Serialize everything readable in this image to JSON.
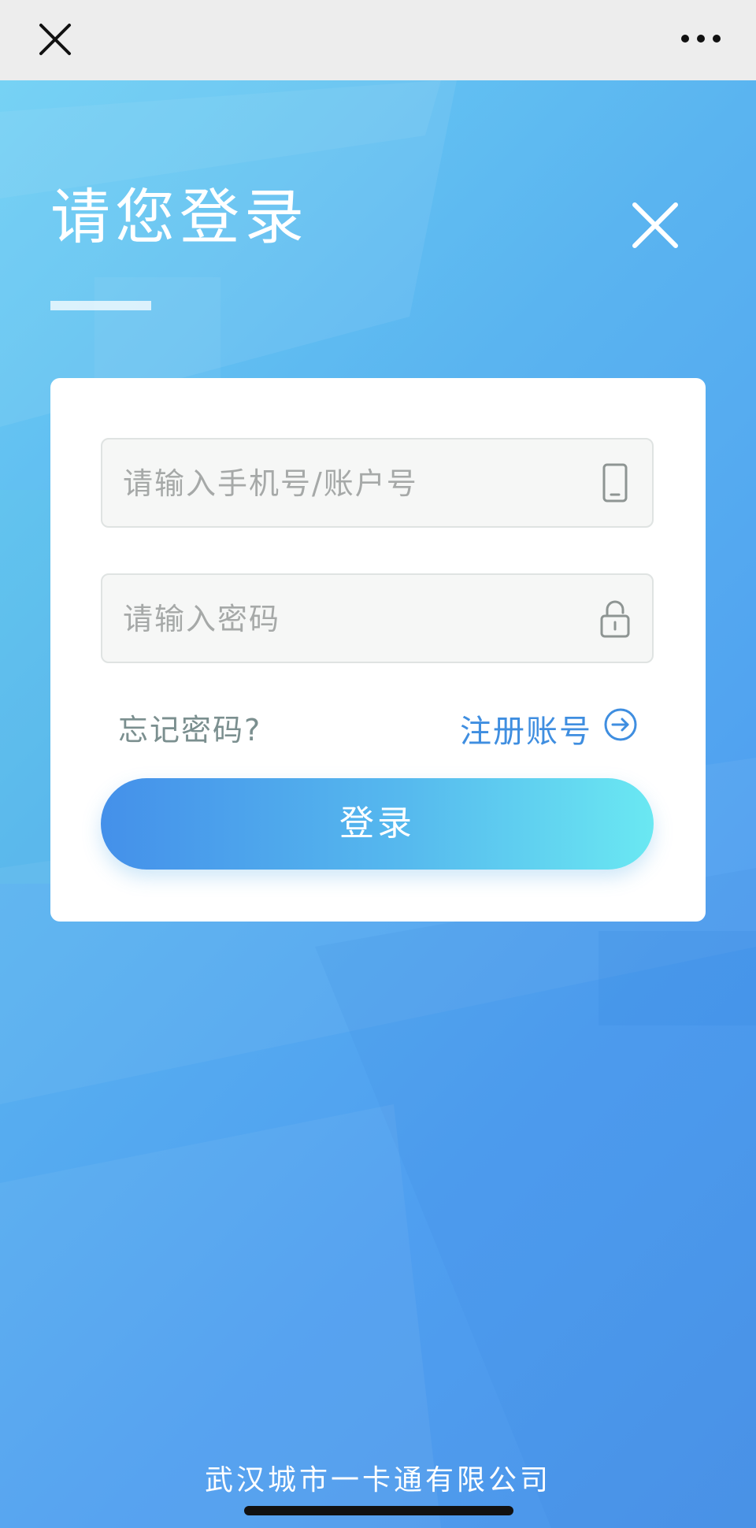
{
  "topbar": {
    "close_icon": "close-icon",
    "more_icon": "more-dots-icon"
  },
  "page": {
    "title": "请您登录",
    "close_icon": "close-icon"
  },
  "form": {
    "account_placeholder": "请输入手机号/账户号",
    "account_icon": "phone-icon",
    "password_placeholder": "请输入密码",
    "password_icon": "lock-icon",
    "forgot_label": "忘记密码?",
    "register_label": "注册账号",
    "register_icon": "arrow-right-circle-icon",
    "login_label": "登录"
  },
  "footer": {
    "company": "武汉城市一卡通有限公司"
  },
  "colors": {
    "accent": "#3f8ee0",
    "button_gradient_start": "#4490ea",
    "button_gradient_end": "#6ae8f2",
    "background_start": "#6ccff4",
    "background_end": "#4c94e8"
  }
}
